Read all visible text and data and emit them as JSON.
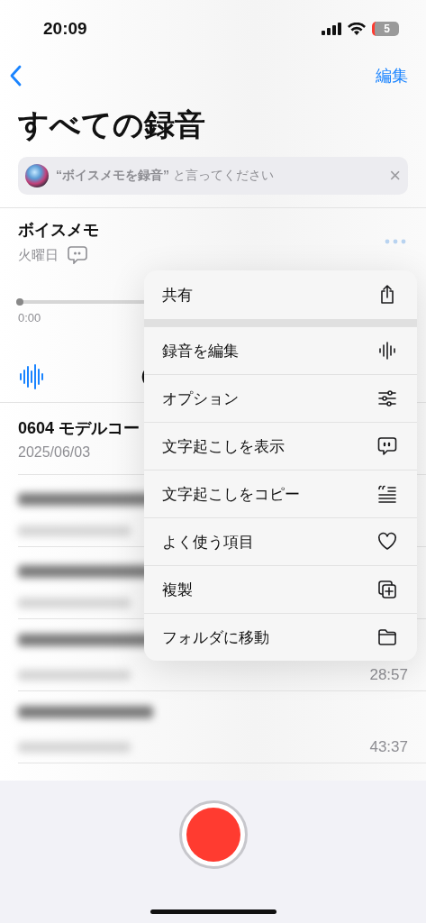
{
  "status_bar": {
    "time": "20:09",
    "battery": "5"
  },
  "nav": {
    "edit": "編集"
  },
  "title": "すべての録音",
  "siri_banner": {
    "text": "**“ボイスメモを録音”** と言ってください",
    "close": "×"
  },
  "current": {
    "title": "ボイスメモ",
    "date": "火曜日",
    "position": "0:00",
    "level": 0
  },
  "recordings": [
    {
      "kind": "plain",
      "title": "0604 モデルコー",
      "date": "2025/06/03"
    },
    {
      "kind": "redacted"
    },
    {
      "kind": "redacted"
    },
    {
      "kind": "redacted",
      "duration": "28:57"
    },
    {
      "kind": "redacted",
      "duration": "43:37"
    }
  ],
  "menu": {
    "items": [
      {
        "label": "共有"
      },
      {
        "label": "録音を編集"
      },
      {
        "label": "オプション"
      },
      {
        "label": "文字起こしを表示"
      },
      {
        "label": "文字起こしをコピー"
      },
      {
        "label": "よく使う項目"
      },
      {
        "label": "複製"
      },
      {
        "label": "フォルダに移動"
      }
    ]
  }
}
